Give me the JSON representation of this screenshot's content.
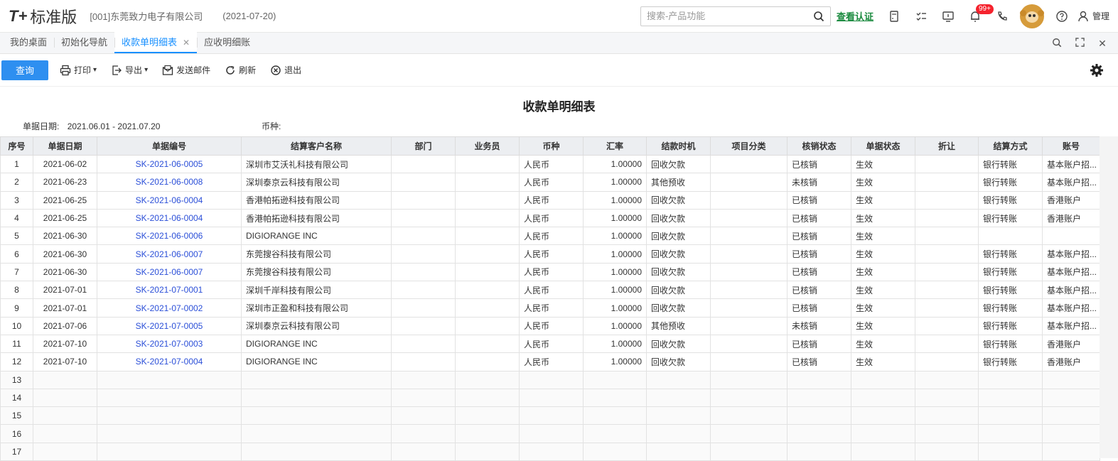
{
  "header": {
    "logo_mark": "T+",
    "logo_text": "标准版",
    "company": "[001]东莞致力电子有限公司",
    "date": "(2021-07-20)",
    "search_placeholder": "搜索-产品功能",
    "verify_link": "查看认证",
    "notification_badge": "99+",
    "admin_label": "管理"
  },
  "tabs": [
    {
      "label": "我的桌面"
    },
    {
      "label": "初始化导航"
    },
    {
      "label": "收款单明细表"
    },
    {
      "label": "应收明细账"
    }
  ],
  "toolbar": {
    "query": "查询",
    "print": "打印",
    "export": "导出",
    "send_mail": "发送邮件",
    "refresh": "刷新",
    "exit": "退出"
  },
  "report": {
    "title": "收款单明细表",
    "date_label": "单据日期:",
    "date_range": "2021.06.01 - 2021.07.20",
    "currency_label": "币种:",
    "currency_value": ""
  },
  "table": {
    "headers": [
      "序号",
      "单据日期",
      "单据编号",
      "结算客户名称",
      "部门",
      "业务员",
      "币种",
      "汇率",
      "结款时机",
      "项目分类",
      "核销状态",
      "单据状态",
      "折让",
      "结算方式",
      "账号"
    ],
    "rows": [
      [
        "1",
        "2021-06-02",
        "SK-2021-06-0005",
        "深圳市艾沃礼科技有限公司",
        "",
        "",
        "人民币",
        "1.00000",
        "回收欠款",
        "",
        "已核销",
        "生效",
        "",
        "银行转账",
        "基本账户招..."
      ],
      [
        "2",
        "2021-06-23",
        "SK-2021-06-0008",
        "深圳泰京云科技有限公司",
        "",
        "",
        "人民币",
        "1.00000",
        "其他预收",
        "",
        "未核销",
        "生效",
        "",
        "银行转账",
        "基本账户招..."
      ],
      [
        "3",
        "2021-06-25",
        "SK-2021-06-0004",
        "香港帕拓逊科技有限公司",
        "",
        "",
        "人民币",
        "1.00000",
        "回收欠款",
        "",
        "已核销",
        "生效",
        "",
        "银行转账",
        "香港账户"
      ],
      [
        "4",
        "2021-06-25",
        "SK-2021-06-0004",
        "香港帕拓逊科技有限公司",
        "",
        "",
        "人民币",
        "1.00000",
        "回收欠款",
        "",
        "已核销",
        "生效",
        "",
        "银行转账",
        "香港账户"
      ],
      [
        "5",
        "2021-06-30",
        "SK-2021-06-0006",
        "DIGIORANGE INC",
        "",
        "",
        "人民币",
        "1.00000",
        "回收欠款",
        "",
        "已核销",
        "生效",
        "",
        "",
        ""
      ],
      [
        "6",
        "2021-06-30",
        "SK-2021-06-0007",
        "东莞搜谷科技有限公司",
        "",
        "",
        "人民币",
        "1.00000",
        "回收欠款",
        "",
        "已核销",
        "生效",
        "",
        "银行转账",
        "基本账户招..."
      ],
      [
        "7",
        "2021-06-30",
        "SK-2021-06-0007",
        "东莞搜谷科技有限公司",
        "",
        "",
        "人民币",
        "1.00000",
        "回收欠款",
        "",
        "已核销",
        "生效",
        "",
        "银行转账",
        "基本账户招..."
      ],
      [
        "8",
        "2021-07-01",
        "SK-2021-07-0001",
        "深圳千岸科技有限公司",
        "",
        "",
        "人民币",
        "1.00000",
        "回收欠款",
        "",
        "已核销",
        "生效",
        "",
        "银行转账",
        "基本账户招..."
      ],
      [
        "9",
        "2021-07-01",
        "SK-2021-07-0002",
        "深圳市正盈和科技有限公司",
        "",
        "",
        "人民币",
        "1.00000",
        "回收欠款",
        "",
        "已核销",
        "生效",
        "",
        "银行转账",
        "基本账户招..."
      ],
      [
        "10",
        "2021-07-06",
        "SK-2021-07-0005",
        "深圳泰京云科技有限公司",
        "",
        "",
        "人民币",
        "1.00000",
        "其他预收",
        "",
        "未核销",
        "生效",
        "",
        "银行转账",
        "基本账户招..."
      ],
      [
        "11",
        "2021-07-10",
        "SK-2021-07-0003",
        "DIGIORANGE INC",
        "",
        "",
        "人民币",
        "1.00000",
        "回收欠款",
        "",
        "已核销",
        "生效",
        "",
        "银行转账",
        "香港账户"
      ],
      [
        "12",
        "2021-07-10",
        "SK-2021-07-0004",
        "DIGIORANGE INC",
        "",
        "",
        "人民币",
        "1.00000",
        "回收欠款",
        "",
        "已核销",
        "生效",
        "",
        "银行转账",
        "香港账户"
      ]
    ],
    "empty_rows": [
      "13",
      "14",
      "15",
      "16",
      "17"
    ]
  }
}
